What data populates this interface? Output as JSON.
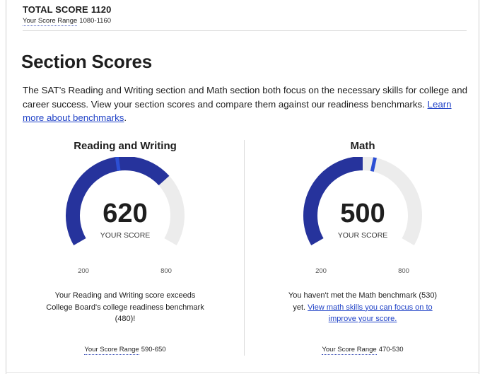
{
  "header": {
    "total_label": "TOTAL SCORE",
    "total_value": "1120",
    "range_label": "Your Score Range",
    "range_value": "1080-1160"
  },
  "section": {
    "heading": "Section Scores",
    "description_text": "The SAT’s Reading and Writing section and Math section both focus on the necessary skills for college and career success. View your section scores and compare them against our readiness benchmarks. ",
    "description_link": "Learn more about benchmarks",
    "description_end": "."
  },
  "scores": [
    {
      "title": "Reading and Writing",
      "score": 620,
      "score_label": "YOUR SCORE",
      "min": 200,
      "max": 800,
      "min_label": "200",
      "max_label": "800",
      "benchmark": 480,
      "message_text": "Your Reading and Writing score exceeds College Board's college readiness benchmark (480)!",
      "message_link": "",
      "range_label": "Your Score Range",
      "range_value": "590-650"
    },
    {
      "title": "Math",
      "score": 500,
      "score_label": "YOUR SCORE",
      "min": 200,
      "max": 800,
      "min_label": "200",
      "max_label": "800",
      "benchmark": 530,
      "message_text": "You haven't met the Math benchmark (530) yet. ",
      "message_link": "View math skills you can focus on to improve your score.",
      "range_label": "Your Score Range",
      "range_value": "470-530"
    }
  ],
  "colors": {
    "fill": "#26339c",
    "track": "#ececec",
    "benchmark": "#2c4fd4",
    "link": "#2143c7"
  }
}
